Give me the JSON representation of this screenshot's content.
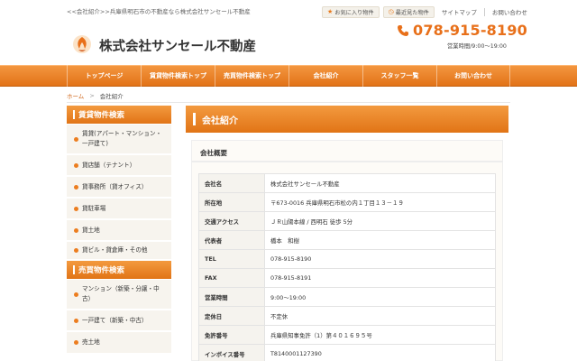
{
  "header": {
    "tagline": "<<会社紹介>>兵庫県明石市の不動産なら株式会社サンセール不動産",
    "favorites_label": "お気に入り物件",
    "recent_label": "最近見た物件",
    "sitemap_label": "サイトマップ",
    "contact_link_label": "お問い合わせ",
    "company_name": "株式会社サンセール不動産",
    "phone": "078-915-8190",
    "hours": "営業時間/9:00～19:00"
  },
  "nav": {
    "items": [
      "トップページ",
      "賃貸物件検索トップ",
      "売買物件検索トップ",
      "会社紹介",
      "スタッフ一覧",
      "お問い合わせ"
    ]
  },
  "breadcrumb": {
    "home": "ホーム",
    "separator": ">",
    "current": "会社紹介"
  },
  "sidebar": {
    "rent_title": "賃貸物件検索",
    "rent_items": [
      "賃貸(アパート・マンション・一戸建て)",
      "貸店舗（テナント）",
      "貸事務所（貸オフィス）",
      "貸駐車場",
      "貸土地",
      "貸ビル・貸倉庫・その他"
    ],
    "sale_title": "売買物件検索",
    "sale_items": [
      "マンション（新築・分譲・中古）",
      "一戸建て（新築・中古）",
      "売土地"
    ]
  },
  "main": {
    "title": "会社紹介",
    "section_title": "会社概要",
    "rows": [
      {
        "label": "会社名",
        "value": "株式会社サンセール不動産"
      },
      {
        "label": "所在地",
        "value": "〒673-0016 兵庫県明石市松の内１丁目１３－１９"
      },
      {
        "label": "交通アクセス",
        "value": "ＪＲ山陽本線 / 西明石 徒歩 5分"
      },
      {
        "label": "代表者",
        "value": "橋本　和樹"
      },
      {
        "label": "TEL",
        "value": "078-915-8190"
      },
      {
        "label": "FAX",
        "value": "078-915-8191"
      },
      {
        "label": "営業時間",
        "value": "9:00～19:00"
      },
      {
        "label": "定休日",
        "value": "不定休"
      },
      {
        "label": "免許番号",
        "value": "兵庫県知事免許（1）第４０１６９５号"
      },
      {
        "label": "インボイス番号",
        "value": "T8140001127390"
      }
    ]
  },
  "colors": {
    "accent": "#e8701a",
    "nav_bg": "#ee8a2e",
    "sidebar_item_bg": "#f7f4ee"
  },
  "icons": {
    "favorites": "star-icon",
    "recent": "clock-icon",
    "phone": "phone-icon",
    "logo": "phoenix-logo-icon"
  }
}
